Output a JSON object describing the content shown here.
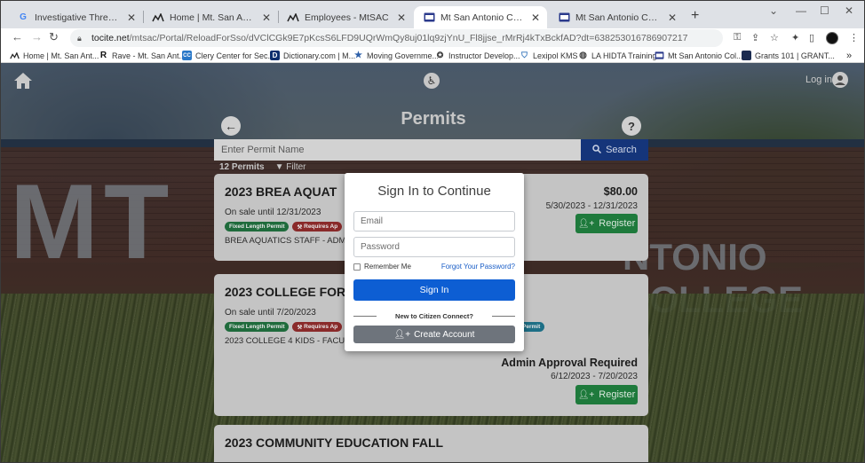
{
  "browser": {
    "tabs": [
      {
        "title": "Investigative Threat Assessment",
        "favicon": "G"
      },
      {
        "title": "Home | Mt. San Antonio College",
        "favicon": "mtsac-icon"
      },
      {
        "title": "Employees - MtSAC",
        "favicon": "mtsac-icon"
      },
      {
        "title": "Mt San Antonio College Citizen",
        "favicon": "citizen-connect-icon",
        "active": true
      },
      {
        "title": "Mt San Antonio College Citizen",
        "favicon": "citizen-connect-icon"
      }
    ],
    "new_tab": "+",
    "url_domain": "tocite.net",
    "url_path": "/mtsac/Portal/ReloadForSso/dVClCGk9E7pKcsS6LFD9UQrWmQy8uj01lq9zjYnU_Fl8jjse_rMrRj4kTxBckfAD?dt=638253016786907217",
    "bookmarks": [
      {
        "label": "Home | Mt. San Ant...",
        "icon": "mtsac-icon"
      },
      {
        "label": "Rave - Mt. San Ant...",
        "icon": "R"
      },
      {
        "label": "Clery Center for Sec...",
        "icon": "clery-icon"
      },
      {
        "label": "Dictionary.com | M...",
        "icon": "D"
      },
      {
        "label": "Moving Governme...",
        "icon": "star-icon"
      },
      {
        "label": "Instructor Develop...",
        "icon": "seal-icon"
      },
      {
        "label": "Lexipol KMS",
        "icon": "shield-icon"
      },
      {
        "label": "LA HIDTA Training",
        "icon": "globe-icon"
      },
      {
        "label": "Mt San Antonio Col...",
        "icon": "citizen-connect-icon"
      },
      {
        "label": "Grants 101 | GRANT...",
        "icon": "grants-icon"
      }
    ],
    "more_bookmarks": "»"
  },
  "colors": {
    "brand_blue": "#15357a",
    "register_green": "#1e7a3c",
    "signin_blue": "#0d5ed3",
    "create_gray": "#6e747c"
  },
  "page": {
    "login_label": "Log in",
    "title": "Permits",
    "search": {
      "placeholder": "Enter Permit Name",
      "button": "Search"
    },
    "count_label": "12 Permits",
    "filter_label": "Filter",
    "background_text_left": "MT",
    "background_text_right": "NTONIO COLLEGE",
    "cards": [
      {
        "title": "2023 BREA AQUAT",
        "sale": "On sale until 12/31/2023",
        "badges": [
          "Fixed Length Permit",
          "Requires Ap"
        ],
        "desc": "BREA AQUATICS STAFF - ADM",
        "price": "$80.00",
        "range": "5/30/2023 - 12/31/2023",
        "register": "Register"
      },
      {
        "title": "2023 COLLEGE FOR",
        "sale": "On sale until 7/20/2023",
        "badges": [
          "Fixed Length Permit",
          "Requires Ap"
        ],
        "badge_extra": "Permit",
        "desc": "2023 COLLEGE 4 KIDS - FACUL",
        "price": "Admin Approval Required",
        "range": "6/12/2023 - 7/20/2023",
        "register": "Register"
      },
      {
        "title": "2023 COMMUNITY EDUCATION FALL"
      }
    ]
  },
  "modal": {
    "title": "Sign In to Continue",
    "email_placeholder": "Email",
    "password_placeholder": "Password",
    "remember": "Remember Me",
    "forgot": "Forgot Your Password?",
    "signin": "Sign In",
    "new_to": "New to Citizen Connect?",
    "create": "Create Account"
  }
}
